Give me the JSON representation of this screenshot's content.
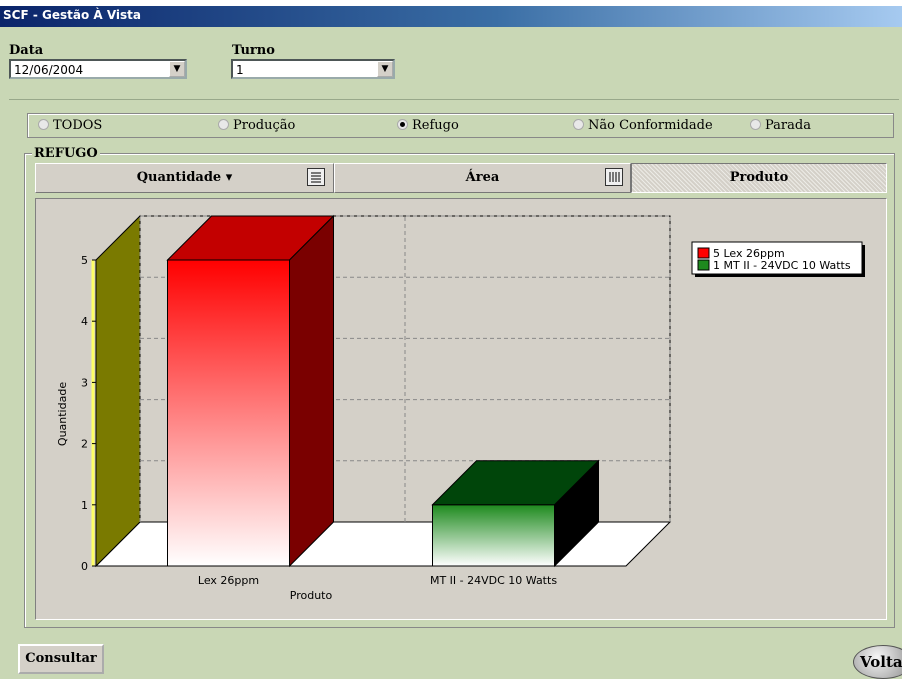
{
  "window": {
    "title": "SCF - Gestão À Vista"
  },
  "filters": {
    "data_label": "Data",
    "data_value": "12/06/2004",
    "turno_label": "Turno",
    "turno_value": "1"
  },
  "radio_options": [
    {
      "label": "TODOS",
      "selected": false
    },
    {
      "label": "Produção",
      "selected": false
    },
    {
      "label": "Refugo",
      "selected": true
    },
    {
      "label": "Não Conformidade",
      "selected": false
    },
    {
      "label": "Parada",
      "selected": false
    }
  ],
  "group": {
    "label": "REFUGO"
  },
  "tabs": [
    {
      "label": "Quantidade ▾",
      "icon": "list-icon"
    },
    {
      "label": "Área",
      "icon": "columns-icon"
    },
    {
      "label": "Produto",
      "icon": ""
    }
  ],
  "buttons": {
    "consult": "Consultar",
    "back": "Voltar"
  },
  "colors": {
    "bar1": "#ff0000",
    "bar2": "#1e8a1e",
    "wall": "#7a7a00",
    "panel": "#d4d0c8"
  },
  "chart_data": {
    "type": "bar",
    "categories": [
      "Lex 26ppm",
      "MT II - 24VDC 10 Watts"
    ],
    "values": [
      5,
      1
    ],
    "xlabel": "Produto",
    "ylabel": "Quantidade",
    "ylim": [
      0,
      5
    ],
    "yticks": [
      "0",
      "1",
      "2",
      "3",
      "4",
      "5"
    ],
    "legend": [
      "5 Lex 26ppm",
      "1 MT II - 24VDC 10 Watts"
    ],
    "legend_position": "top-right",
    "grid": true
  }
}
